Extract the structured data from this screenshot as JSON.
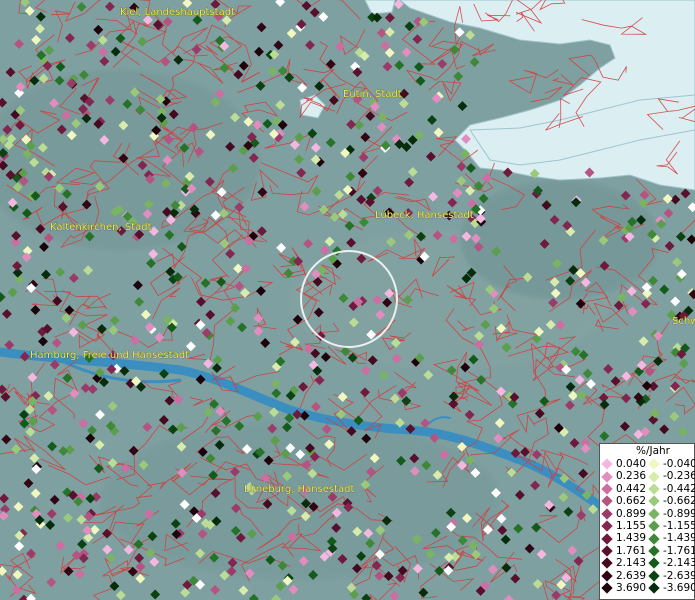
{
  "places": [
    {
      "name": "Kiel, Landeshauptstadt"
    },
    {
      "name": "Eutin, Stadt"
    },
    {
      "name": "Lübeck, Hansestadt"
    },
    {
      "name": "Kaltenkirchen, Stadt"
    },
    {
      "name": "Hamburg, Freie und Hansestadt"
    },
    {
      "name": "Lüneburg, Hansestadt"
    },
    {
      "name": "Schw"
    }
  ],
  "legend": {
    "title": "%/Jahr",
    "positive": [
      {
        "label": "0.040",
        "color": "#f4b8e0"
      },
      {
        "label": "0.236",
        "color": "#e28dbf"
      },
      {
        "label": "0.442",
        "color": "#cc6ea2"
      },
      {
        "label": "0.662",
        "color": "#b45483"
      },
      {
        "label": "0.899",
        "color": "#9b3b69"
      },
      {
        "label": "1.155",
        "color": "#832650"
      },
      {
        "label": "1.439",
        "color": "#6d1a3c"
      },
      {
        "label": "1.761",
        "color": "#58102c"
      },
      {
        "label": "2.143",
        "color": "#440a1f"
      },
      {
        "label": "2.639",
        "color": "#300514"
      },
      {
        "label": "3.690",
        "color": "#1e020b"
      }
    ],
    "negative": [
      {
        "label": "-0.040",
        "color": "#f0f8c0"
      },
      {
        "label": "-0.236",
        "color": "#d7ecaa"
      },
      {
        "label": "-0.442",
        "color": "#bbdc94"
      },
      {
        "label": "-0.662",
        "color": "#9bc97b"
      },
      {
        "label": "-0.899",
        "color": "#7ab463"
      },
      {
        "label": "-1.155",
        "color": "#5b9e4c"
      },
      {
        "label": "-1.439",
        "color": "#3f8838"
      },
      {
        "label": "-1.761",
        "color": "#267228"
      },
      {
        "label": "-2.143",
        "color": "#145a1b"
      },
      {
        "label": "-2.639",
        "color": "#0a4212"
      },
      {
        "label": "-3.690",
        "color": "#062c0b"
      }
    ]
  },
  "colors": {
    "water": "#dbeef2",
    "land": "#7fa0a0",
    "river": "#3a8fc0",
    "borders": "#d63b3b",
    "label": "#f3e84a",
    "highlight": "#ffffff"
  }
}
